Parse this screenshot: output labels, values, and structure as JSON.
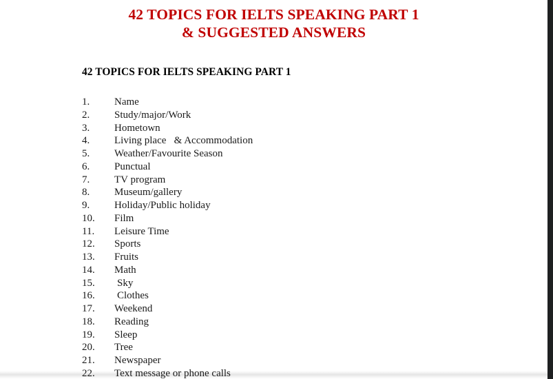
{
  "document": {
    "title_lines": [
      "42 TOPICS FOR IELTS SPEAKING PART 1",
      "& SUGGESTED ANSWERS"
    ],
    "section_heading": "42 TOPICS FOR IELTS SPEAKING PART 1",
    "title_color": "#C00000",
    "body_color": "#1a1a1a",
    "page_background": "#ffffff",
    "gutter_color": "#1e2021"
  },
  "topics": [
    {
      "num": "1.",
      "label": "Name",
      "indented": false
    },
    {
      "num": "2.",
      "label": "Study/major/Work",
      "indented": false
    },
    {
      "num": "3.",
      "label": "Hometown",
      "indented": false
    },
    {
      "num": "4.",
      "label": "Living place   & Accommodation",
      "indented": false
    },
    {
      "num": "5.",
      "label": "Weather/Favourite Season",
      "indented": false
    },
    {
      "num": "6.",
      "label": "Punctual",
      "indented": false
    },
    {
      "num": "7.",
      "label": "TV program",
      "indented": false
    },
    {
      "num": "8.",
      "label": "Museum/gallery",
      "indented": false
    },
    {
      "num": "9.",
      "label": "Holiday/Public holiday",
      "indented": false
    },
    {
      "num": "10.",
      "label": "Film",
      "indented": false
    },
    {
      "num": "11.",
      "label": "Leisure Time",
      "indented": false
    },
    {
      "num": "12.",
      "label": "Sports",
      "indented": false
    },
    {
      "num": "13.",
      "label": "Fruits",
      "indented": false
    },
    {
      "num": "14.",
      "label": "Math",
      "indented": false
    },
    {
      "num": "15.",
      "label": "Sky",
      "indented": true
    },
    {
      "num": "16.",
      "label": "Clothes",
      "indented": true
    },
    {
      "num": "17.",
      "label": "Weekend",
      "indented": false
    },
    {
      "num": "18.",
      "label": "Reading",
      "indented": false
    },
    {
      "num": "19.",
      "label": "Sleep",
      "indented": false
    },
    {
      "num": "20.",
      "label": "Tree",
      "indented": false
    },
    {
      "num": "21.",
      "label": "Newspaper",
      "indented": false
    },
    {
      "num": "22.",
      "label": "Text message or phone calls",
      "indented": false
    }
  ]
}
